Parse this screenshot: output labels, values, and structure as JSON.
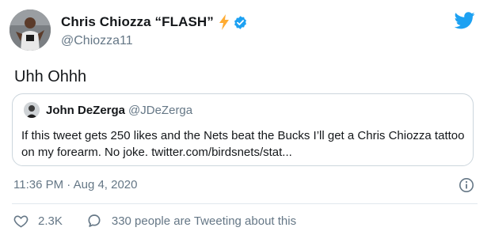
{
  "author": {
    "display_name": "Chris Chiozza “FLASH”",
    "handle": "@Chiozza11",
    "emoji_icon": "lightning-bolt-icon",
    "verified_icon": "verified-badge-icon"
  },
  "tweet": {
    "text": "Uhh Ohhh"
  },
  "quoted_tweet": {
    "display_name": "John DeZerga",
    "handle": "@JDeZerga",
    "text": "If this tweet gets 250 likes and the Nets beat the Bucks I’ll get a Chris Chiozza tattoo on my forearm. No joke. twitter.com/birdsnets/stat..."
  },
  "meta": {
    "timestamp": "11:36 PM · Aug 4, 2020"
  },
  "actions": {
    "like_count": "2.3K",
    "reply_text": "330 people are Tweeting about this"
  },
  "colors": {
    "brand_blue": "#1da1f2",
    "text_primary": "#14171a",
    "text_secondary": "#657786",
    "border": "#ccd6dd",
    "bolt_yellow": "#ffac33"
  }
}
